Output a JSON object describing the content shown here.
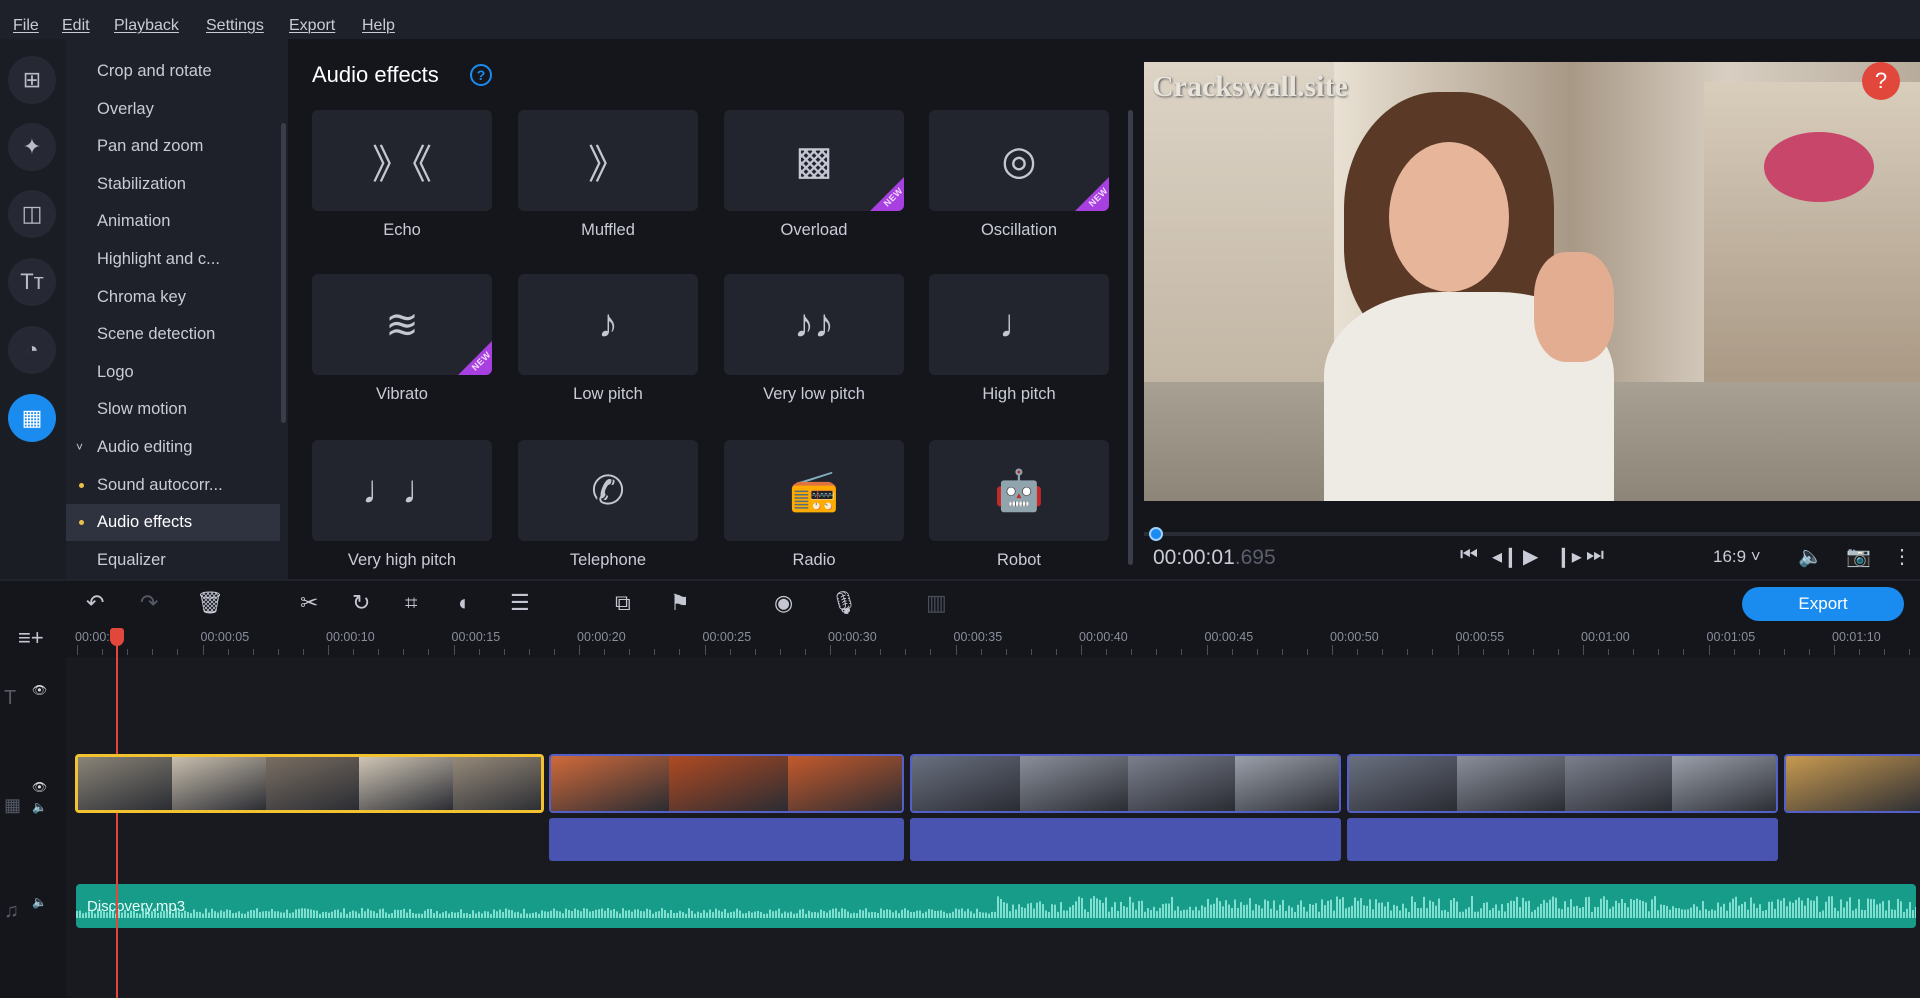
{
  "menu": [
    "File",
    "Edit",
    "Playback",
    "Settings",
    "Export",
    "Help"
  ],
  "rail": [
    {
      "icon": "add-media-icon",
      "g": "⊞"
    },
    {
      "icon": "magic-wand-icon",
      "g": "✦"
    },
    {
      "icon": "transitions-icon",
      "g": "◫"
    },
    {
      "icon": "titles-icon",
      "g": "Tт"
    },
    {
      "icon": "stickers-icon",
      "g": "◔"
    },
    {
      "icon": "more-tools-icon",
      "g": "▦",
      "active": true
    }
  ],
  "sidebar": {
    "items": [
      {
        "label": "Crop and rotate"
      },
      {
        "label": "Overlay"
      },
      {
        "label": "Pan and zoom"
      },
      {
        "label": "Stabilization"
      },
      {
        "label": "Animation"
      },
      {
        "label": "Highlight and c..."
      },
      {
        "label": "Chroma key"
      },
      {
        "label": "Scene detection"
      },
      {
        "label": "Logo"
      },
      {
        "label": "Slow motion"
      },
      {
        "label": "Audio editing",
        "group": true
      },
      {
        "label": "Sound autocorr...",
        "dot": true
      },
      {
        "label": "Audio effects",
        "dot": true,
        "selected": true
      },
      {
        "label": "Equalizer"
      }
    ]
  },
  "effects": {
    "title": "Audio effects",
    "help": "?",
    "new_badge": "NEW",
    "tiles": [
      {
        "label": "Echo",
        "g": "》《"
      },
      {
        "label": "Muffled",
        "g": "》"
      },
      {
        "label": "Overload",
        "g": "▩",
        "new": true
      },
      {
        "label": "Oscillation",
        "g": "◎",
        "new": true
      },
      {
        "label": "Vibrato",
        "g": "≋",
        "new": true
      },
      {
        "label": "Low pitch",
        "g": "♪"
      },
      {
        "label": "Very low pitch",
        "g": "♪♪"
      },
      {
        "label": "High pitch",
        "g": "♩"
      },
      {
        "label": "Very high pitch",
        "g": "♩♩"
      },
      {
        "label": "Telephone",
        "g": "✆"
      },
      {
        "label": "Radio",
        "g": "📻"
      },
      {
        "label": "Robot",
        "g": "🤖"
      }
    ]
  },
  "preview": {
    "watermark": "Crackswall.site",
    "help": "?",
    "timecode": "00:00:01",
    "timecode_ms": ".695",
    "aspect": "16:9 ˅",
    "position_fraction": 0.02
  },
  "toolbar": {
    "export_label": "Export"
  },
  "ruler": [
    "00:00:00",
    "00:00:05",
    "00:00:10",
    "00:00:15",
    "00:00:20",
    "00:00:25",
    "00:00:30",
    "00:00:35",
    "00:00:40",
    "00:00:45",
    "00:00:50",
    "00:00:55",
    "00:01:00",
    "00:01:05",
    "00:01:10"
  ],
  "timeline": {
    "music_file": "Discovery.mp3",
    "colors": {
      "accent": "#1a8cf0",
      "playhead": "#e2473c",
      "audio_clip": "#4953b0",
      "music": "#179c8a",
      "new_badge": "#a83fe0"
    }
  }
}
